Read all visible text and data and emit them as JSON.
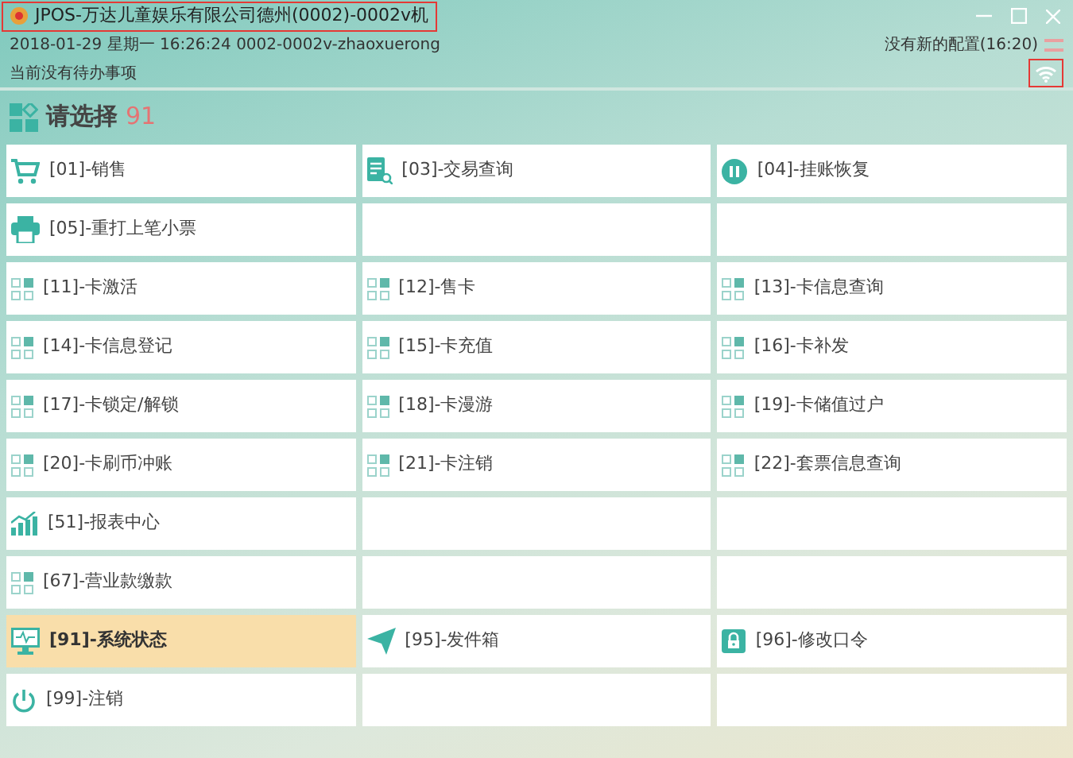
{
  "window": {
    "title": "JPOS-万达儿童娱乐有限公司德州(0002)-0002v机"
  },
  "info": {
    "datetime": "2018-01-29 星期一 16:26:24 0002-0002v-zhaoxuerong",
    "config": "没有新的配置(16:20)",
    "pending": "当前没有待办事项"
  },
  "header": {
    "title": "请选择",
    "code": "91"
  },
  "menu": [
    {
      "kind": "cart",
      "label": "[01]-销售",
      "selected": false
    },
    {
      "kind": "search",
      "label": "[03]-交易查询",
      "selected": false
    },
    {
      "kind": "pause",
      "label": "[04]-挂账恢复",
      "selected": false
    },
    {
      "kind": "printer",
      "label": "[05]-重打上笔小票",
      "selected": false
    },
    {
      "kind": "empty"
    },
    {
      "kind": "empty"
    },
    {
      "kind": "grid",
      "label": "[11]-卡激活",
      "selected": false
    },
    {
      "kind": "grid",
      "label": "[12]-售卡",
      "selected": false
    },
    {
      "kind": "grid",
      "label": "[13]-卡信息查询",
      "selected": false
    },
    {
      "kind": "grid",
      "label": "[14]-卡信息登记",
      "selected": false
    },
    {
      "kind": "grid",
      "label": "[15]-卡充值",
      "selected": false
    },
    {
      "kind": "grid",
      "label": "[16]-卡补发",
      "selected": false
    },
    {
      "kind": "grid",
      "label": "[17]-卡锁定/解锁",
      "selected": false
    },
    {
      "kind": "grid",
      "label": "[18]-卡漫游",
      "selected": false
    },
    {
      "kind": "grid",
      "label": "[19]-卡储值过户",
      "selected": false
    },
    {
      "kind": "grid",
      "label": "[20]-卡刷币冲账",
      "selected": false
    },
    {
      "kind": "grid",
      "label": "[21]-卡注销",
      "selected": false
    },
    {
      "kind": "grid",
      "label": "[22]-套票信息查询",
      "selected": false
    },
    {
      "kind": "chart",
      "label": "[51]-报表中心",
      "selected": false
    },
    {
      "kind": "empty"
    },
    {
      "kind": "empty"
    },
    {
      "kind": "grid",
      "label": "[67]-营业款缴款",
      "selected": false
    },
    {
      "kind": "empty"
    },
    {
      "kind": "empty"
    },
    {
      "kind": "monitor",
      "label": "[91]-系统状态",
      "selected": true
    },
    {
      "kind": "send",
      "label": "[95]-发件箱",
      "selected": false
    },
    {
      "kind": "lock",
      "label": "[96]-修改口令",
      "selected": false
    },
    {
      "kind": "power",
      "label": "[99]-注销",
      "selected": false
    },
    {
      "kind": "empty"
    },
    {
      "kind": "empty"
    }
  ]
}
